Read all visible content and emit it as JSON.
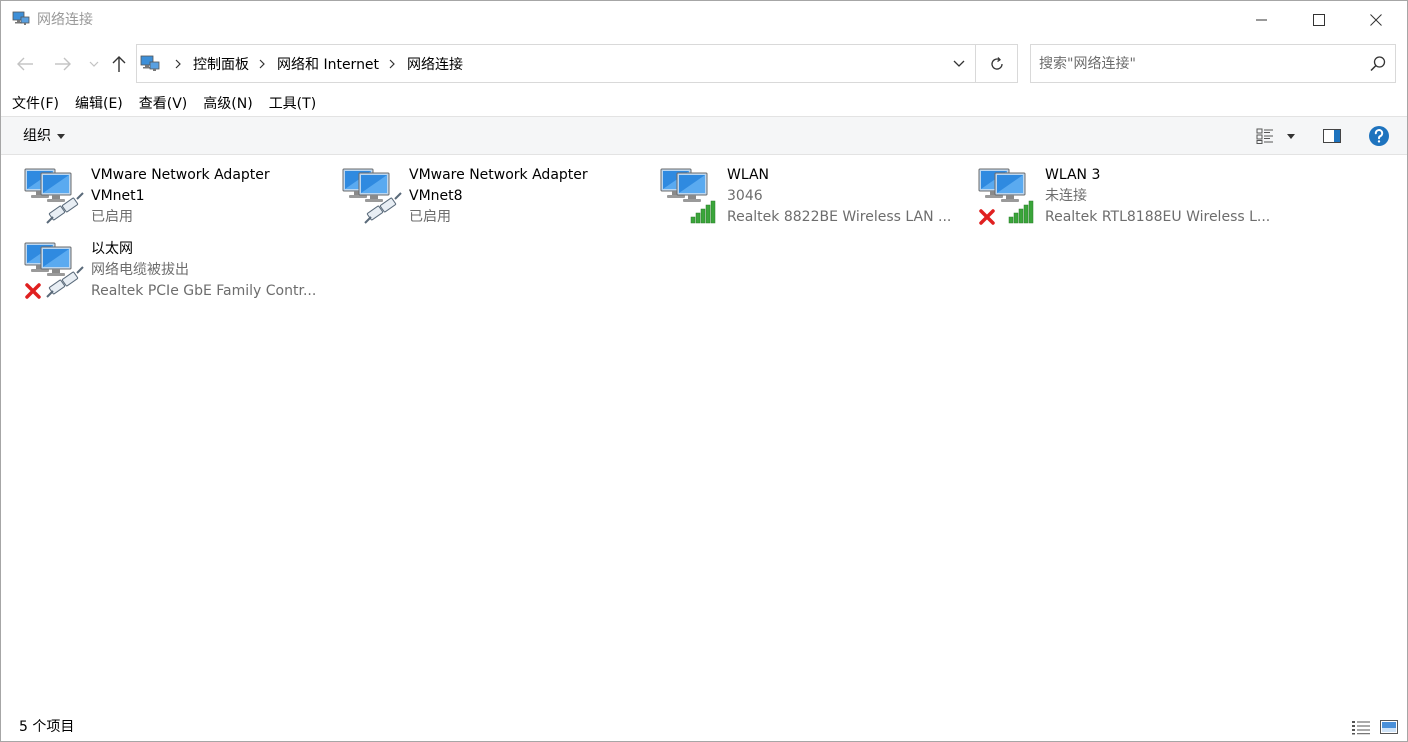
{
  "window": {
    "title": "网络连接",
    "icon": "network-connections-icon"
  },
  "navigation": {
    "back_icon": "arrow-left-icon",
    "forward_icon": "arrow-right-icon",
    "recent_icon": "chevron-down-icon",
    "up_icon": "arrow-up-icon"
  },
  "address": {
    "breadcrumbs": [
      "控制面板",
      "网络和 Internet",
      "网络连接"
    ]
  },
  "search": {
    "placeholder": "搜索\"网络连接\""
  },
  "menu": {
    "items": [
      "文件(F)",
      "编辑(E)",
      "查看(V)",
      "高级(N)",
      "工具(T)"
    ]
  },
  "commandbar": {
    "organize_label": "组织"
  },
  "connections": [
    {
      "name": "VMware Network Adapter VMnet1",
      "name_lines": [
        "VMware Network Adapter",
        "VMnet1"
      ],
      "status": "已启用",
      "device": "",
      "kind": "ethernet",
      "disconnected": false
    },
    {
      "name": "VMware Network Adapter VMnet8",
      "name_lines": [
        "VMware Network Adapter",
        "VMnet8"
      ],
      "status": "已启用",
      "device": "",
      "kind": "ethernet",
      "disconnected": false
    },
    {
      "name": "WLAN",
      "name_lines": [
        "WLAN"
      ],
      "status": "3046",
      "device": "Realtek 8822BE Wireless LAN ...",
      "kind": "wireless",
      "disconnected": false
    },
    {
      "name": "WLAN 3",
      "name_lines": [
        "WLAN 3"
      ],
      "status": "未连接",
      "device": "Realtek RTL8188EU Wireless L...",
      "kind": "wireless",
      "disconnected": true
    },
    {
      "name": "以太网",
      "name_lines": [
        "以太网"
      ],
      "status": "网络电缆被拔出",
      "device": "Realtek PCIe GbE Family Contr...",
      "kind": "ethernet",
      "disconnected": true
    }
  ],
  "statusbar": {
    "count": "5 个项目"
  },
  "colors": {
    "accent": "#0063b1",
    "help_blue": "#1e73be",
    "disconnected_red": "#e02020",
    "signal_green": "#3aa53a",
    "muted_text": "#6d6d6d"
  }
}
